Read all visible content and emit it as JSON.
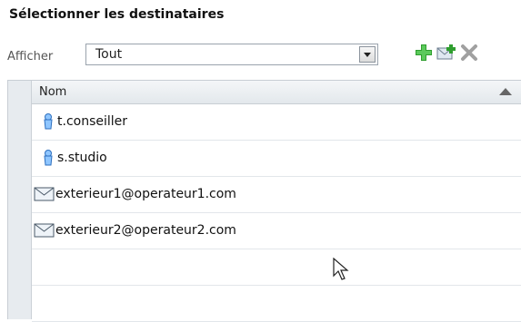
{
  "panel": {
    "title": "Sélectionner les destinataires"
  },
  "filter": {
    "label": "Afficher",
    "selected": "Tout"
  },
  "toolbar": {
    "buttons": [
      {
        "icon": "add-icon",
        "color": "#2f9e2f"
      },
      {
        "icon": "add-contact-icon",
        "color": "#4a8ed6"
      },
      {
        "icon": "delete-icon",
        "color": "#a0a0a0"
      }
    ]
  },
  "grid": {
    "column_header": "Nom",
    "rows": [
      {
        "icon": "user-icon",
        "text": "t.conseiller"
      },
      {
        "icon": "user-icon",
        "text": "s.studio"
      },
      {
        "icon": "envelope-icon",
        "text": "exterieur1@operateur1.com"
      },
      {
        "icon": "envelope-icon",
        "text": "exterieur2@operateur2.com"
      },
      {
        "icon": "",
        "text": ""
      },
      {
        "icon": "",
        "text": ""
      }
    ]
  }
}
